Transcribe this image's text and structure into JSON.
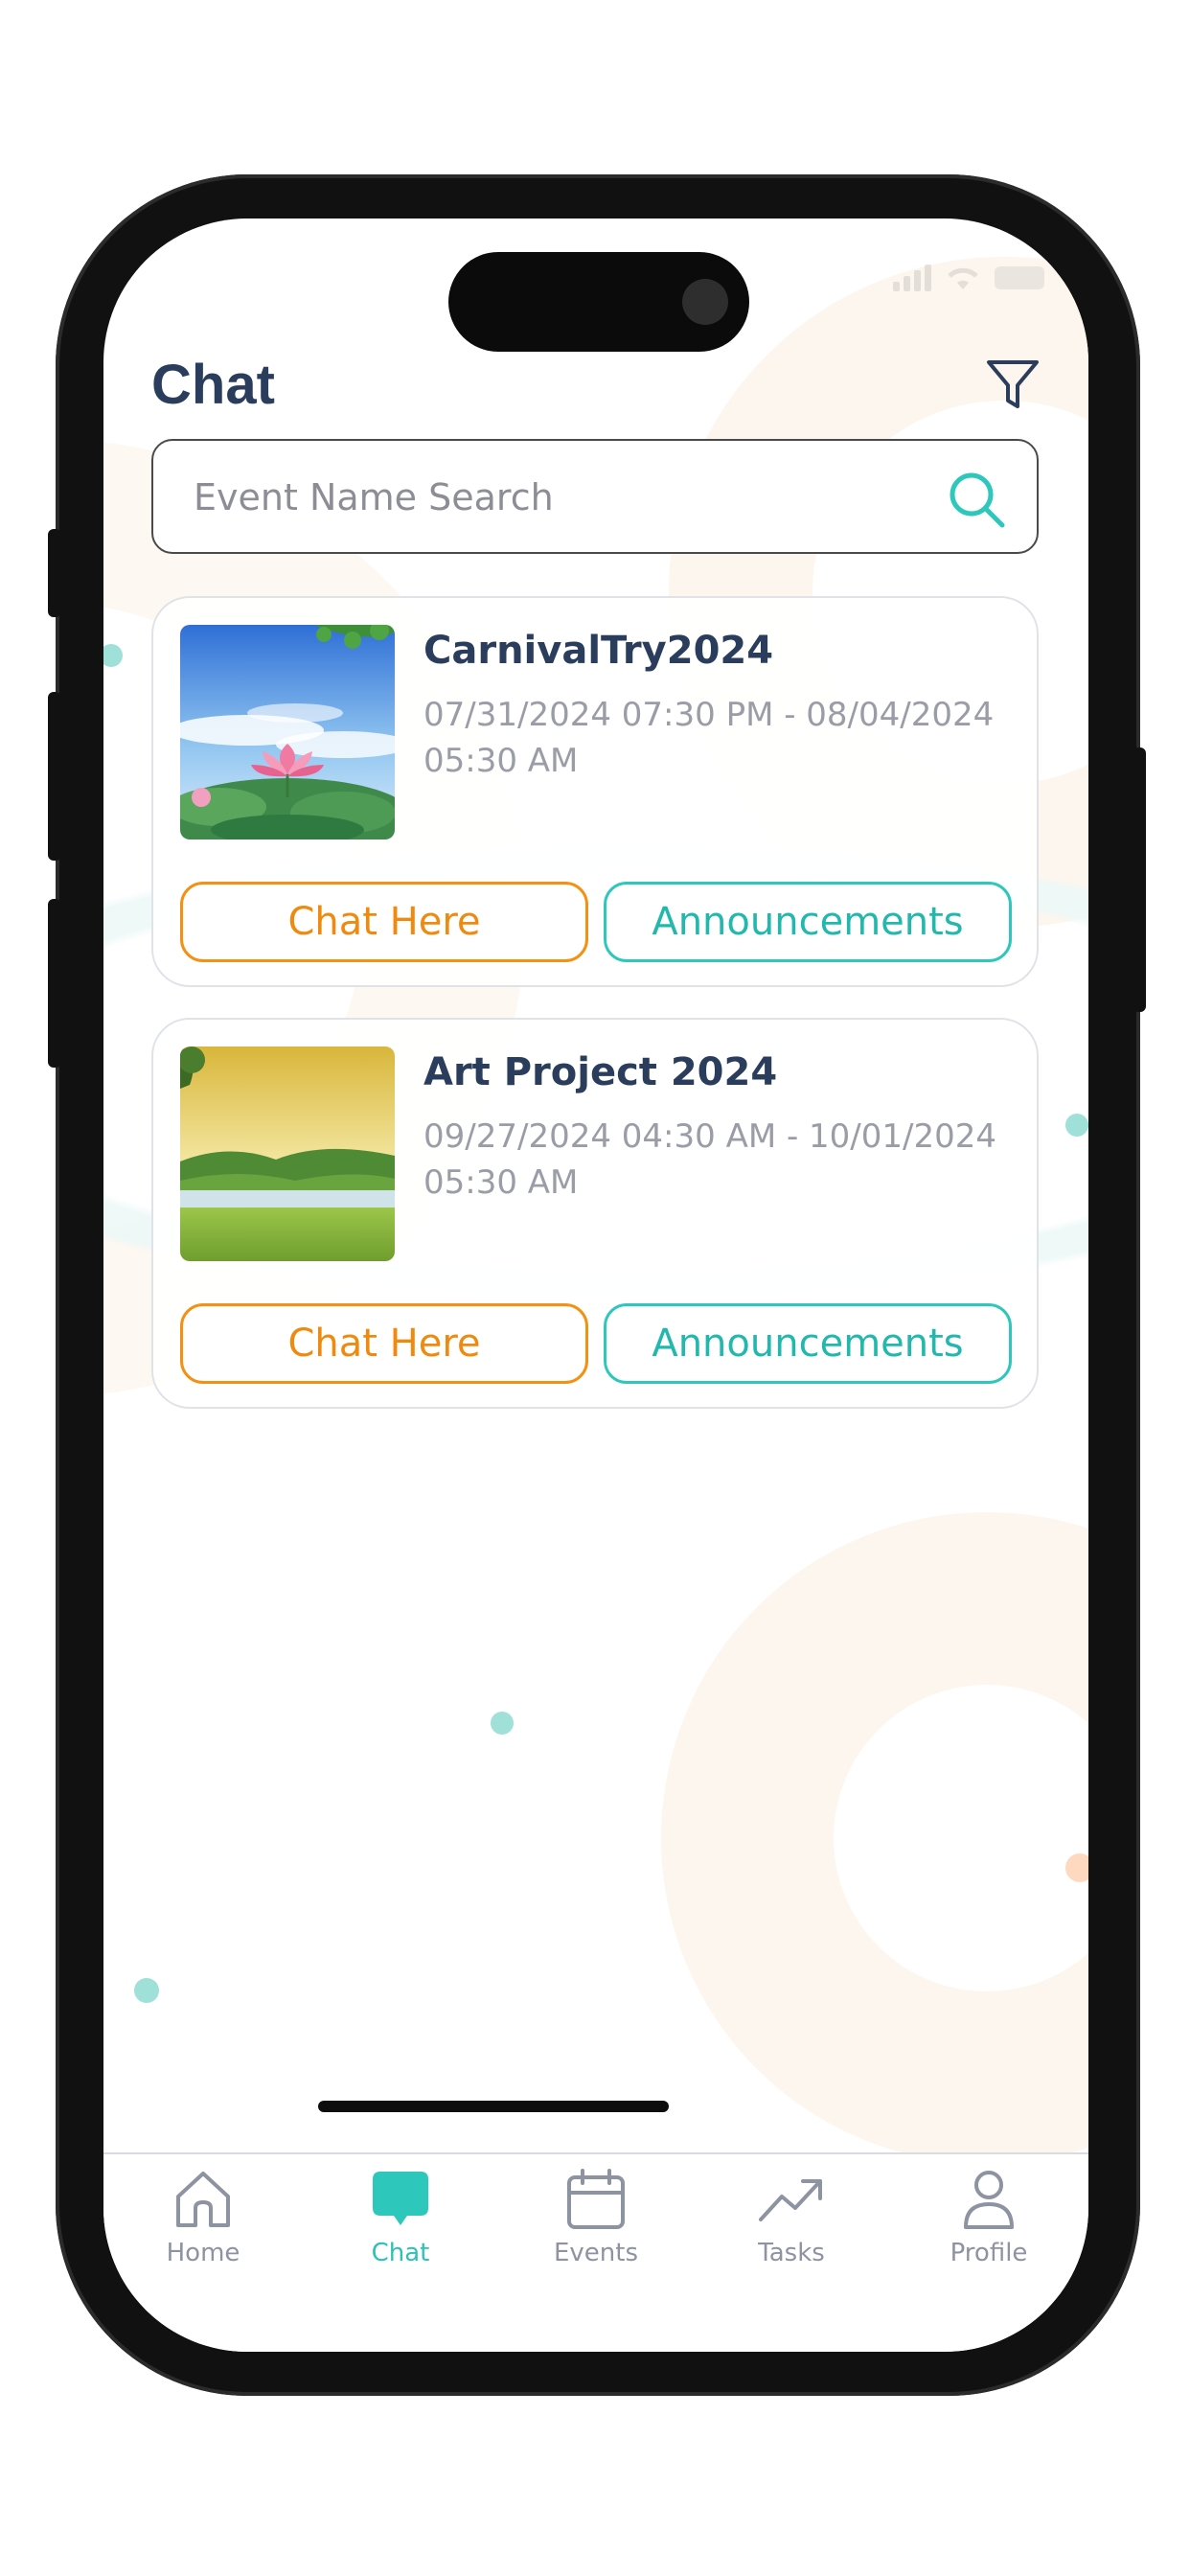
{
  "header": {
    "title": "Chat"
  },
  "search": {
    "placeholder": "Event Name Search"
  },
  "events": [
    {
      "name": "CarnivalTry2024",
      "dates": "07/31/2024 07:30 PM - 08/04/2024 05:30 AM",
      "chat_label": "Chat Here",
      "announcements_label": "Announcements"
    },
    {
      "name": "Art Project 2024",
      "dates": "09/27/2024 04:30 AM - 10/01/2024 05:30 AM",
      "chat_label": "Chat Here",
      "announcements_label": "Announcements"
    }
  ],
  "tabbar": {
    "items": [
      {
        "label": "Home",
        "icon": "home-icon",
        "active": false
      },
      {
        "label": "Chat",
        "icon": "chat-bubble-icon",
        "active": true
      },
      {
        "label": "Events",
        "icon": "calendar-icon",
        "active": false
      },
      {
        "label": "Tasks",
        "icon": "trending-up-icon",
        "active": false
      },
      {
        "label": "Profile",
        "icon": "user-icon",
        "active": false
      }
    ]
  },
  "colors": {
    "title": "#2b3d5c",
    "accent_teal": "#2ec7bc",
    "accent_orange": "#f49012",
    "muted_text": "#9a9ca6"
  }
}
